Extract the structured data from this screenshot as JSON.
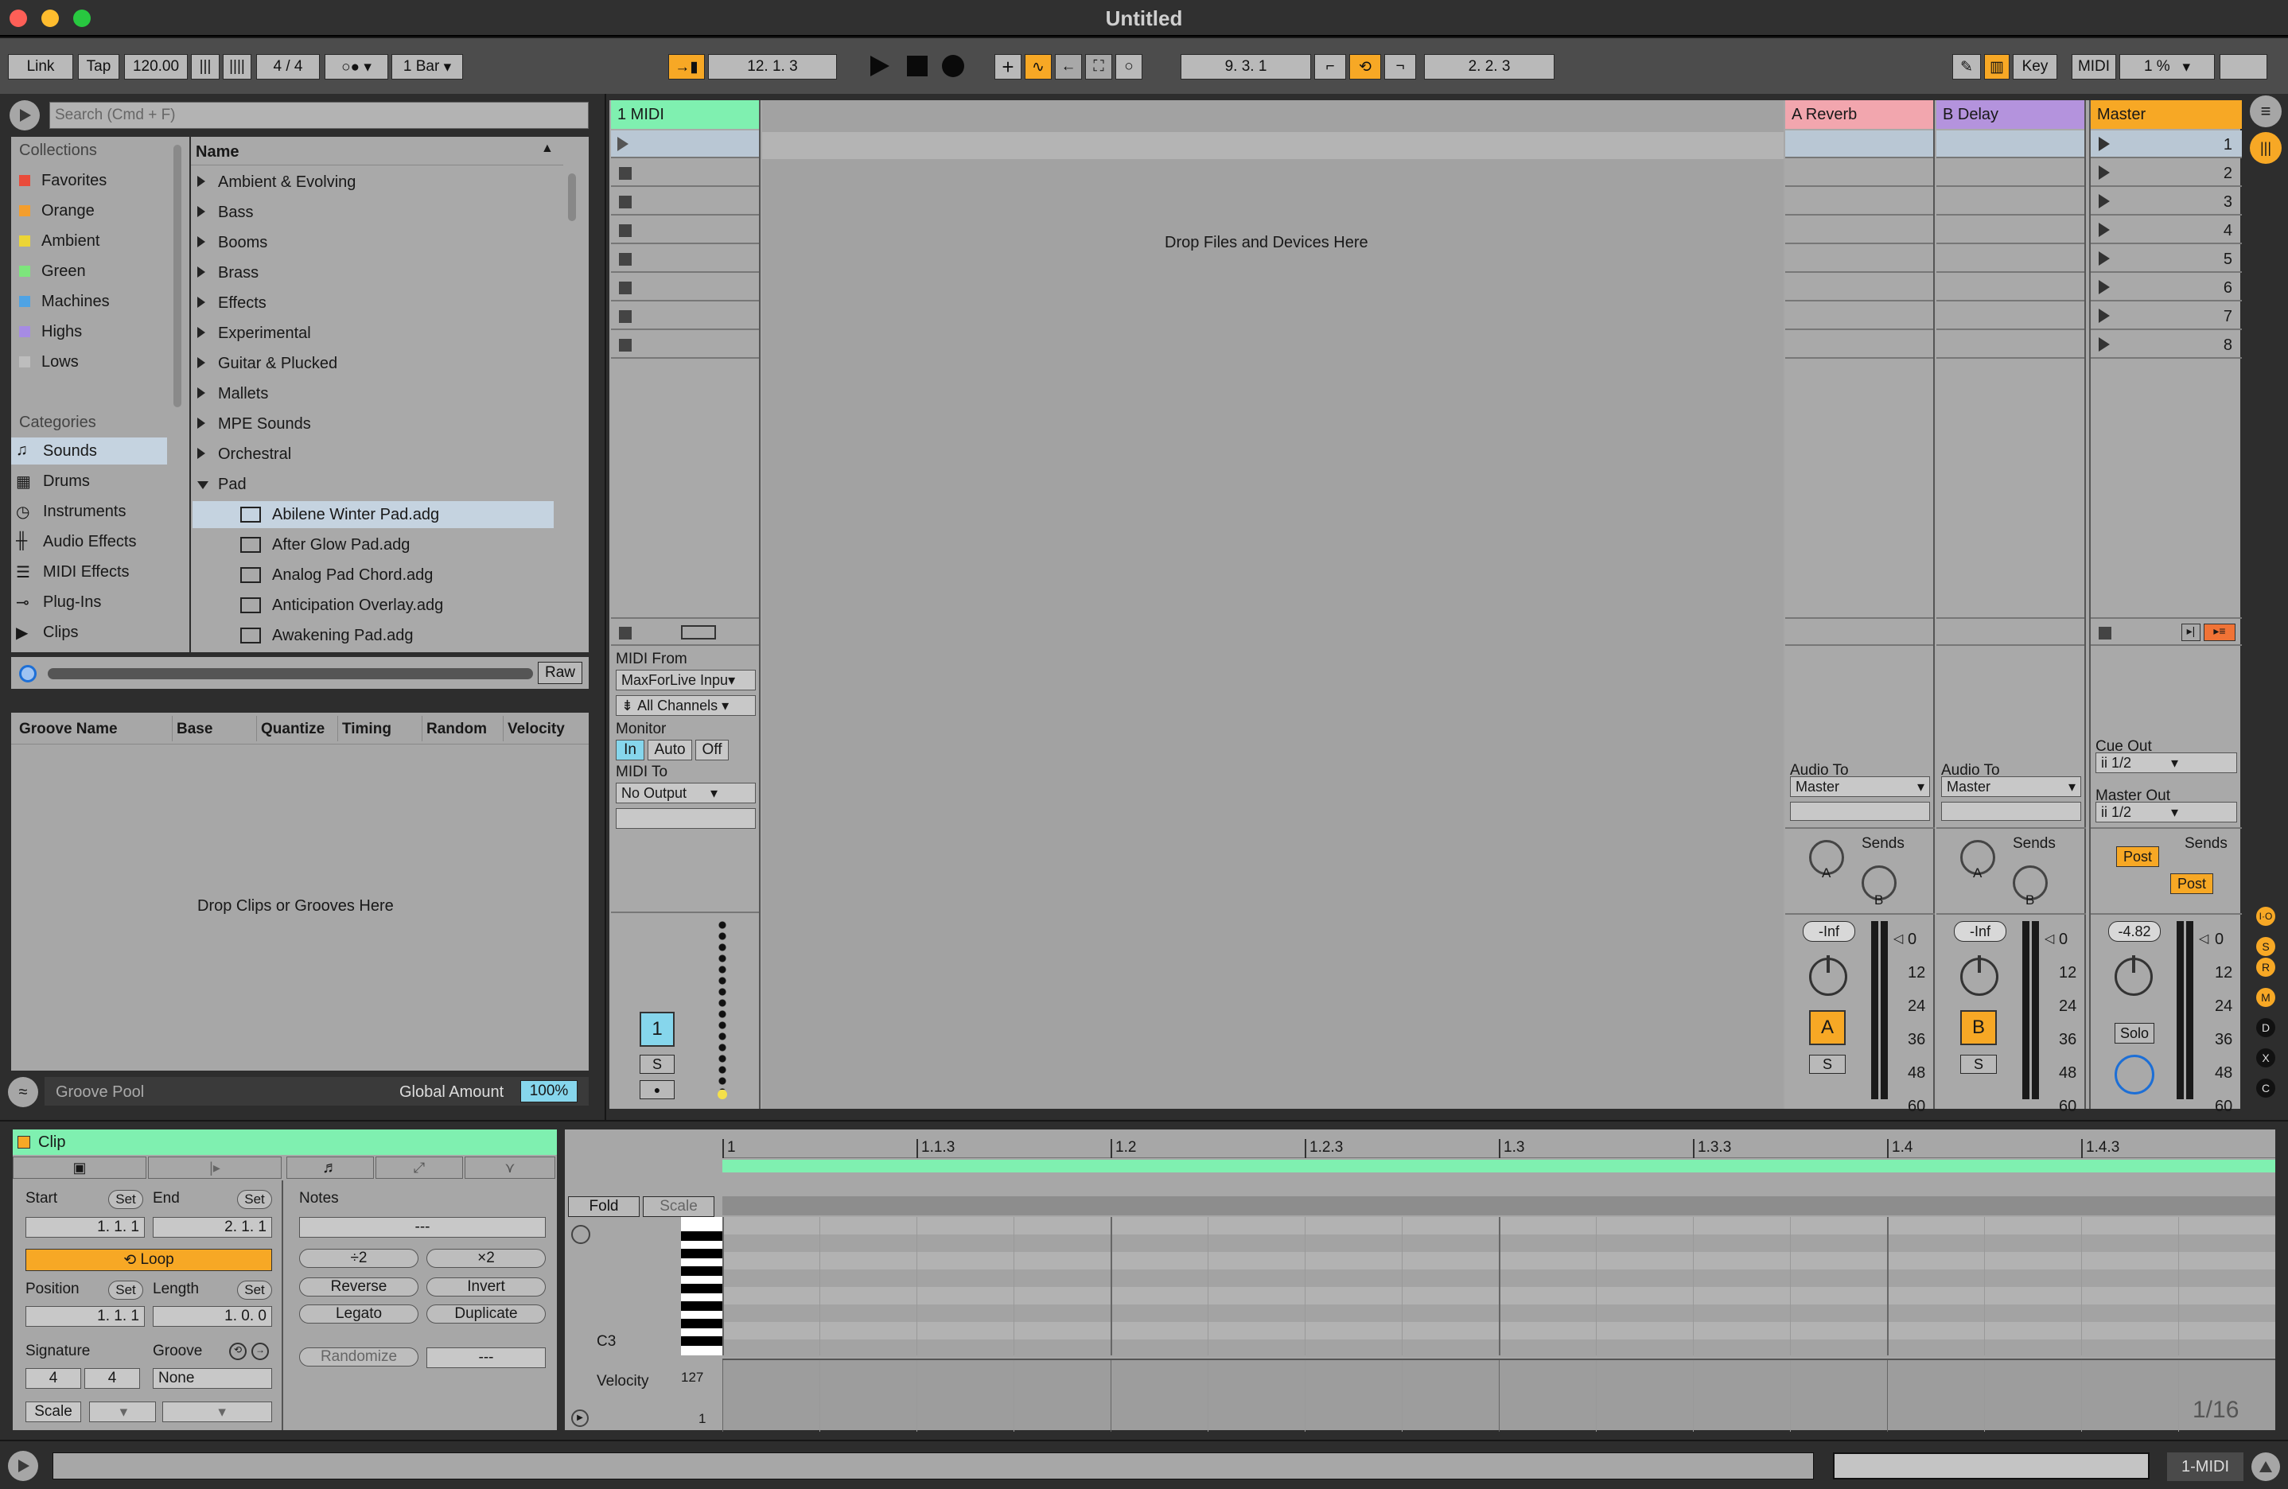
{
  "window": {
    "title": "Untitled"
  },
  "control_bar": {
    "link": "Link",
    "tap": "Tap",
    "tempo": "120.00",
    "sig": "4 / 4",
    "quantize": "1 Bar",
    "arr_pos": "12.  1.  3",
    "loop_start": "9.  3.  1",
    "loop_len": "2.  2.  3",
    "key": "Key",
    "midi": "MIDI",
    "cpu": "1 %"
  },
  "browser": {
    "search_placeholder": "Search (Cmd + F)",
    "collections_header": "Collections",
    "collections": [
      {
        "label": "Favorites",
        "color": "#e94b3a"
      },
      {
        "label": "Orange",
        "color": "#f49e2d"
      },
      {
        "label": "Ambient",
        "color": "#ecd536"
      },
      {
        "label": "Green",
        "color": "#7de57c"
      },
      {
        "label": "Machines",
        "color": "#4fa3e4"
      },
      {
        "label": "Highs",
        "color": "#a68be4"
      },
      {
        "label": "Lows",
        "color": "#bdbdbd"
      }
    ],
    "categories_header": "Categories",
    "categories": [
      {
        "label": "Sounds",
        "icon": "note-icon"
      },
      {
        "label": "Drums",
        "icon": "grid-icon"
      },
      {
        "label": "Instruments",
        "icon": "clock-icon"
      },
      {
        "label": "Audio Effects",
        "icon": "waveform-icon"
      },
      {
        "label": "MIDI Effects",
        "icon": "sliders-icon"
      },
      {
        "label": "Plug-Ins",
        "icon": "plug-icon"
      },
      {
        "label": "Clips",
        "icon": "play-box-icon"
      }
    ],
    "name_header": "Name",
    "folders": [
      "Ambient & Evolving",
      "Bass",
      "Booms",
      "Brass",
      "Effects",
      "Experimental",
      "Guitar & Plucked",
      "Mallets",
      "MPE Sounds",
      "Orchestral",
      "Pad"
    ],
    "files": [
      "Abilene Winter Pad.adg",
      "After Glow Pad.adg",
      "Analog Pad Chord.adg",
      "Anticipation Overlay.adg",
      "Awakening Pad.adg"
    ],
    "raw": "Raw"
  },
  "groove": {
    "headers": [
      "Groove Name",
      "Base",
      "Quantize",
      "Timing",
      "Random",
      "Velocity"
    ],
    "drop_text": "Drop Clips or Grooves Here",
    "pool": "Groove Pool",
    "global_amount_label": "Global Amount",
    "global_amount": "100%"
  },
  "session": {
    "midi_track": "1 MIDI",
    "drop_text": "Drop Files and Devices Here",
    "returns": [
      {
        "name": "A Reverb",
        "color": "#f2a6ae",
        "letter": "A",
        "db": "-Inf"
      },
      {
        "name": "B Delay",
        "color": "#b493dd",
        "letter": "B",
        "db": "-Inf"
      }
    ],
    "master": {
      "name": "Master",
      "color": "#f7a825",
      "db": "-4.82",
      "solo": "Solo",
      "cue_out": "Cue Out",
      "cue_val": "ii 1/2",
      "master_out": "Master Out",
      "master_val": "ii 1/2",
      "post": "Post"
    },
    "scenes": [
      "1",
      "2",
      "3",
      "4",
      "5",
      "6",
      "7",
      "8"
    ],
    "io": {
      "midi_from": "MIDI From",
      "from_val": "MaxForLive Inpu",
      "channels": "All Channels",
      "monitor": "Monitor",
      "in": "In",
      "auto": "Auto",
      "off": "Off",
      "midi_to": "MIDI To",
      "to_val": "No Output",
      "audio_to": "Audio To",
      "audio_val": "Master",
      "sends": "Sends",
      "send_a": "A",
      "send_b": "B"
    },
    "track_num": "1",
    "solo": "S",
    "meter_ticks": [
      "0",
      "12",
      "24",
      "36",
      "48",
      "60"
    ]
  },
  "clip": {
    "title": "Clip",
    "start": "Start",
    "end": "End",
    "set": "Set",
    "start_val": "1.  1.  1",
    "end_val": "2.  1.  1",
    "loop": "Loop",
    "position": "Position",
    "length": "Length",
    "pos_val": "1.  1.  1",
    "len_val": "1.  0.  0",
    "signature": "Signature",
    "groove": "Groove",
    "sig_n": "4",
    "sig_d": "4",
    "groove_val": "None",
    "scale": "Scale",
    "notes": "Notes",
    "notes_val": "---",
    "half": "÷2",
    "double": "×2",
    "reverse": "Reverse",
    "invert": "Invert",
    "legato": "Legato",
    "duplicate": "Duplicate",
    "randomize": "Randomize",
    "rand_val": "---"
  },
  "piano": {
    "fold": "Fold",
    "scale": "Scale",
    "ruler": [
      "1",
      "1.1.3",
      "1.2",
      "1.2.3",
      "1.3",
      "1.3.3",
      "1.4",
      "1.4.3"
    ],
    "c3": "C3",
    "velocity": "Velocity",
    "v127": "127",
    "v1": "1",
    "grid": "1/16"
  },
  "status": {
    "track": "1-MIDI"
  }
}
